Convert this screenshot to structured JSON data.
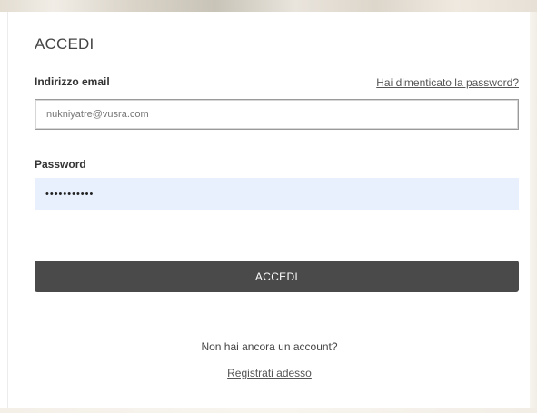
{
  "login": {
    "title": "ACCEDI",
    "email_label": "Indirizzo email",
    "forgot_password_link": "Hai dimenticato la password?",
    "email_value": "nukniyatre@vusra.com",
    "password_label": "Password",
    "password_value": "•••••••••••",
    "submit_label": "ACCEDI",
    "no_account_text": "Non hai ancora un account?",
    "register_link": "Registrati adesso"
  },
  "colors": {
    "button_background": "#4a4a4a",
    "autofill_background": "#e8f0fe",
    "text_dark": "#333333"
  }
}
